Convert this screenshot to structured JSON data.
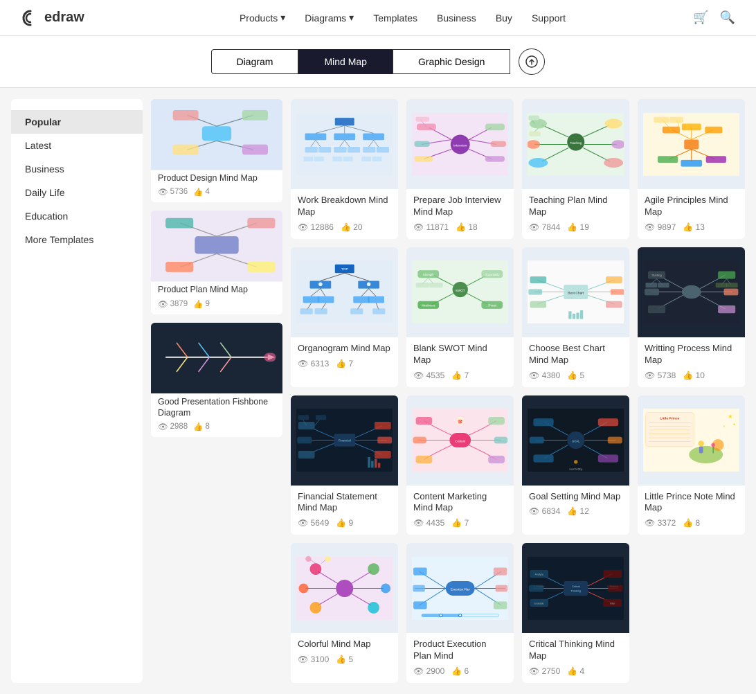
{
  "header": {
    "logo_text": "edraw",
    "nav_items": [
      {
        "label": "Products",
        "has_arrow": true
      },
      {
        "label": "Diagrams",
        "has_arrow": true
      },
      {
        "label": "Templates",
        "has_arrow": false
      },
      {
        "label": "Business",
        "has_arrow": false
      },
      {
        "label": "Buy",
        "has_arrow": false
      },
      {
        "label": "Support",
        "has_arrow": false
      }
    ]
  },
  "tabs": {
    "items": [
      "Diagram",
      "Mind Map",
      "Graphic Design"
    ],
    "active": "Mind Map",
    "upload_title": "Upload"
  },
  "sidebar": {
    "items": [
      {
        "label": "Popular",
        "active": true
      },
      {
        "label": "Latest"
      },
      {
        "label": "Business"
      },
      {
        "label": "Daily Life"
      },
      {
        "label": "Education"
      },
      {
        "label": "More Templates"
      }
    ]
  },
  "left_cards": [
    {
      "title": "Product Design Mind Map",
      "views": "5736",
      "likes": "4",
      "thumb_type": "light_blue"
    },
    {
      "title": "Product Plan Mind Map",
      "views": "3879",
      "likes": "9",
      "thumb_type": "light_purple"
    },
    {
      "title": "Good Presentation Fishbone Diagram",
      "views": "2988",
      "likes": "8",
      "thumb_type": "dark"
    }
  ],
  "cards": [
    {
      "title": "Work Breakdown Mind Map",
      "views": "12886",
      "likes": "20",
      "thumb_type": "org_blue"
    },
    {
      "title": "Prepare Job Interview Mind Map",
      "views": "11871",
      "likes": "18",
      "thumb_type": "colorful_center"
    },
    {
      "title": "Teaching Plan Mind Map",
      "views": "7844",
      "likes": "19",
      "thumb_type": "radial_dark"
    },
    {
      "title": "Agile Principles Mind Map",
      "views": "9897",
      "likes": "13",
      "thumb_type": "colorful_tree"
    },
    {
      "title": "Organogram Mind Map",
      "views": "6313",
      "likes": "7",
      "thumb_type": "org_dark_blue"
    },
    {
      "title": "Blank SWOT Mind Map",
      "views": "4535",
      "likes": "7",
      "thumb_type": "swot_green"
    },
    {
      "title": "Choose Best Chart Mind Map",
      "views": "4380",
      "likes": "5",
      "thumb_type": "compare_light"
    },
    {
      "title": "Writting Process Mind Map",
      "views": "5738",
      "likes": "10",
      "thumb_type": "dark_radial"
    },
    {
      "title": "Financial Statement Mind Map",
      "views": "5649",
      "likes": "9",
      "thumb_type": "dark_financial"
    },
    {
      "title": "Content Marketing Mind Map",
      "views": "4435",
      "likes": "7",
      "thumb_type": "colorful_branches"
    },
    {
      "title": "Goal Setting Mind Map",
      "views": "6834",
      "likes": "12",
      "thumb_type": "dark_goal"
    },
    {
      "title": "Little Prince Note Mind Map",
      "views": "3372",
      "likes": "8",
      "thumb_type": "little_prince"
    },
    {
      "title": "Colorful Mind Map",
      "views": "3100",
      "likes": "5",
      "thumb_type": "colorful_bubbles"
    },
    {
      "title": "Product Execution Plan Mind",
      "views": "2900",
      "likes": "6",
      "thumb_type": "exec_plan"
    },
    {
      "title": "Critical Thinking Mind Map",
      "views": "2750",
      "likes": "4",
      "thumb_type": "dark_critical"
    }
  ],
  "icons": {
    "eye": "👁",
    "like": "👍",
    "cart": "🛒",
    "search": "🔍",
    "upload": "⬆",
    "chevron": "▾"
  }
}
